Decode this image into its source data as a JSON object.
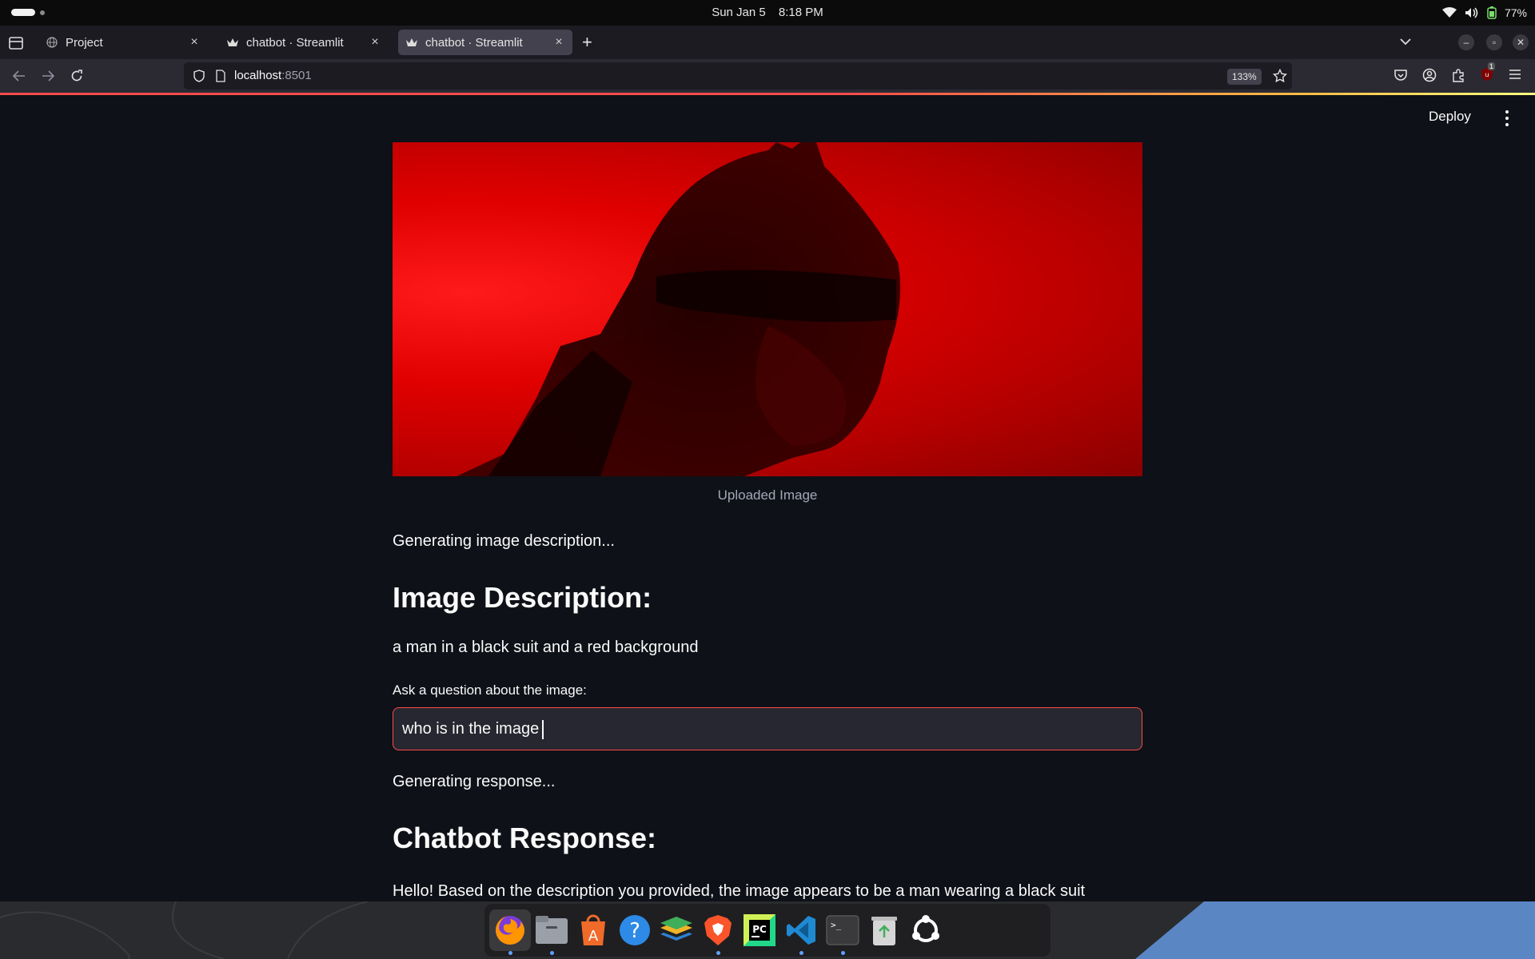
{
  "system": {
    "date": "Sun Jan 5",
    "time": "8:18 PM",
    "battery": "77%"
  },
  "browser": {
    "tabs": [
      {
        "label": "Project",
        "active": false
      },
      {
        "label": "chatbot · Streamlit",
        "active": false
      },
      {
        "label": "chatbot · Streamlit",
        "active": true
      }
    ],
    "url_host": "localhost",
    "url_port": ":8501",
    "zoom": "133%",
    "extension_badge": "1"
  },
  "app": {
    "deploy_label": "Deploy",
    "image_caption": "Uploaded Image",
    "status_description": "Generating image description...",
    "description_heading": "Image Description:",
    "description_text": "a man in a black suit and a red background",
    "question_label": "Ask a question about the image:",
    "question_value": "who is in the image",
    "status_response": "Generating response...",
    "response_heading": "Chatbot Response:",
    "response_text": "Hello! Based on the description you provided, the image appears to be a man wearing a black suit"
  },
  "dock": {
    "items": [
      "firefox-icon",
      "files-icon",
      "app-center-icon",
      "help-icon",
      "layers-icon",
      "brave-icon",
      "pycharm-icon",
      "vscode-icon",
      "terminal-icon",
      "trash-icon",
      "ubuntu-icon"
    ]
  },
  "colors": {
    "app_background": "#0e1117",
    "accent": "#ff4b4b",
    "input_background": "#262730",
    "browser_chrome": "#2b2a33"
  }
}
